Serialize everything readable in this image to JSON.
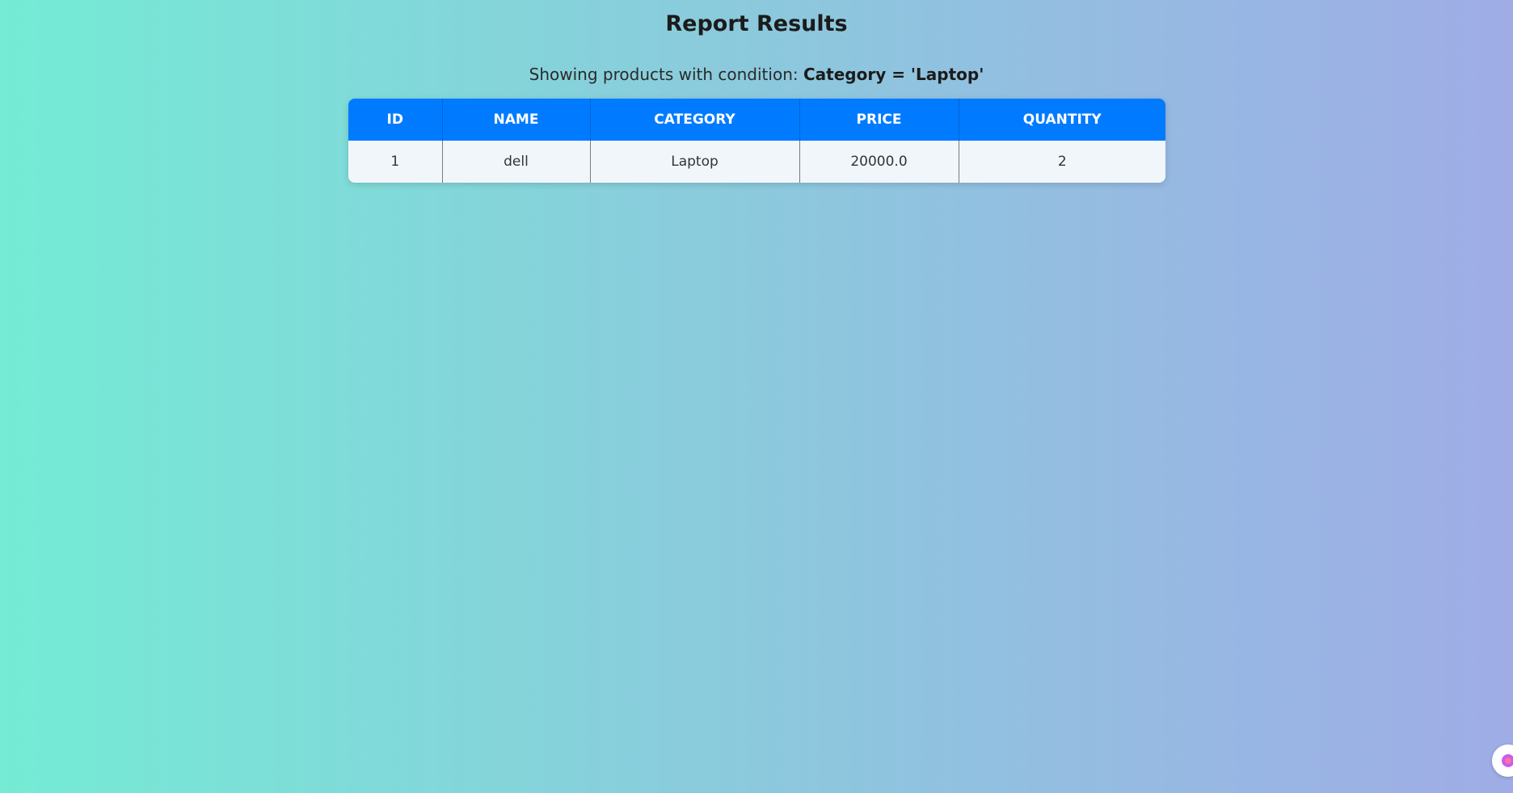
{
  "page": {
    "title": "Report Results",
    "subtitle_prefix": "Showing products with condition: ",
    "condition": "Category = 'Laptop'"
  },
  "table": {
    "columns": [
      "ID",
      "NAME",
      "CATEGORY",
      "PRICE",
      "QUANTITY"
    ],
    "rows": [
      [
        "1",
        "dell",
        "Laptop",
        "20000.0",
        "2"
      ]
    ]
  },
  "colors": {
    "header_bg": "#007bff",
    "row_bg": "#f1f6fb",
    "gradient_start": "#74ebd5",
    "gradient_end": "#9face6"
  },
  "icons": {
    "floating_button": "assistant-icon"
  }
}
